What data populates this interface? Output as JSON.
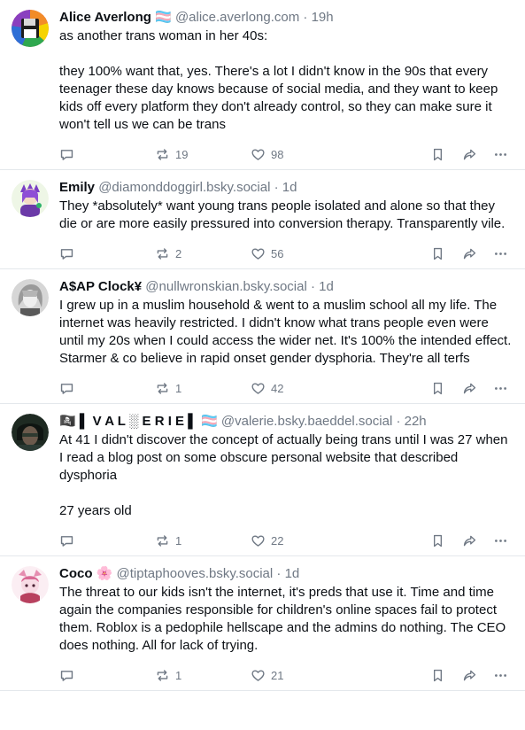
{
  "posts": [
    {
      "name": "Alice Averlong 🏳️‍⚧️",
      "handle": "@alice.averlong.com",
      "time": "19h",
      "text": "as another trans woman in her 40s:\n\nthey 100% want that, yes. There's a lot I didn't know in the 90s that every teenager these day knows because of social media, and they want to keep kids off every platform they don't already control, so they can make sure it won't tell us we can be trans",
      "reposts": "19",
      "likes": "98",
      "avatar": "rainbow-floppy"
    },
    {
      "name": "Emily",
      "handle": "@diamonddoggirl.bsky.social",
      "time": "1d",
      "text": "They *absolutely* want young trans people isolated and alone so that they die or are more easily pressured into conversion therapy. Transparently vile.",
      "reposts": "2",
      "likes": "56",
      "avatar": "purple-character"
    },
    {
      "name": "A$AP Clock¥",
      "handle": "@nullwronskian.bsky.social",
      "time": "1d",
      "text": "I grew up in a muslim household & went to a muslim school all my life. The internet was heavily restricted. I didn't know what trans people even were until my 20s when I could access the wider net. It's 100% the intended effect. Starmer & co believe in rapid onset gender dysphoria. They're all terfs",
      "reposts": "1",
      "likes": "42",
      "avatar": "gray-sketch"
    },
    {
      "name": "🏴‍☠️ ▌ V A L ░ E R I E ▌ 🏳️‍⚧️",
      "handle": "@valerie.bsky.baeddel.social",
      "time": "22h",
      "text": "At 41 I didn't discover the concept of actually being trans until I was 27 when I read a blog post on some obscure personal website that described dysphoria\n\n27 years old",
      "reposts": "1",
      "likes": "22",
      "avatar": "dark-photo"
    },
    {
      "name": "Coco 🌸",
      "handle": "@tiptaphooves.bsky.social",
      "time": "1d",
      "text": "The threat to our kids isn't the internet, it's preds that use it. Time and time again the companies responsible for children's online spaces fail to protect them. Roblox is a pedophile hellscape and the admins do nothing. The CEO does nothing. All for lack of trying.",
      "reposts": "1",
      "likes": "21",
      "avatar": "pink-character"
    }
  ],
  "separator": "·",
  "colors": {
    "muted": "#6f7884",
    "text": "#0b0f14",
    "border": "#e4e8ec"
  }
}
